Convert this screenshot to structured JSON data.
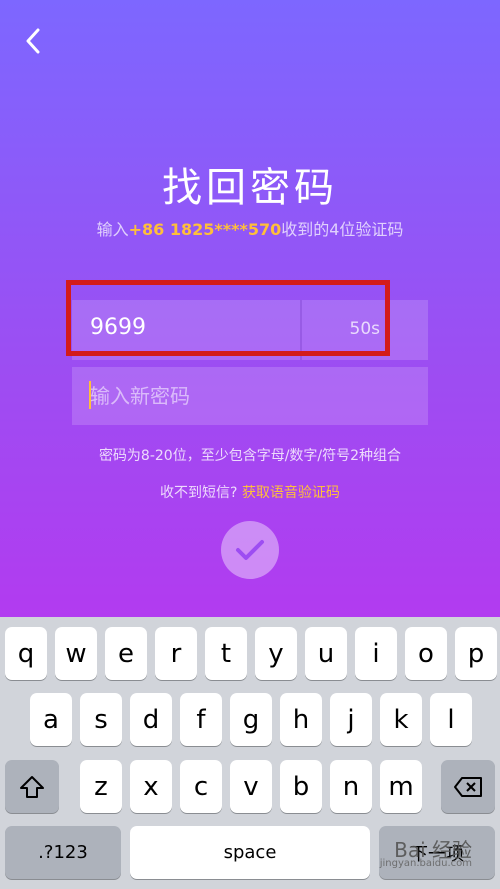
{
  "header": {
    "back_icon": "chevron-left-icon",
    "title": "找回密码",
    "subtitle_prefix": "输入",
    "phone": "+86 1825****570",
    "subtitle_suffix": "收到的4位验证码"
  },
  "form": {
    "code_value": "9699",
    "countdown": "50s",
    "password_placeholder": "输入新密码",
    "password_hint": "密码为8-20位，至少包含字母/数字/符号2种组合",
    "sms_prompt": "收不到短信?",
    "voice_code_link": "获取语音验证码",
    "confirm_icon": "checkmark-icon"
  },
  "keyboard": {
    "row1": [
      "q",
      "w",
      "e",
      "r",
      "t",
      "y",
      "u",
      "i",
      "o",
      "p"
    ],
    "row2": [
      "a",
      "s",
      "d",
      "f",
      "g",
      "h",
      "j",
      "k",
      "l"
    ],
    "row3": [
      "z",
      "x",
      "c",
      "v",
      "b",
      "n",
      "m"
    ],
    "shift_icon": "shift-icon",
    "delete_icon": "backspace-icon",
    "numbers_label": ".?123",
    "space_label": "space",
    "return_label": "下一项"
  },
  "watermark": {
    "brand": "Bai 经验",
    "url": "jingyan.baidu.com"
  },
  "colors": {
    "accent": "#ffbf3a",
    "highlight_border": "#d31b1b",
    "gradient_top": "#7d67ff",
    "gradient_bottom": "#b23bf0"
  }
}
